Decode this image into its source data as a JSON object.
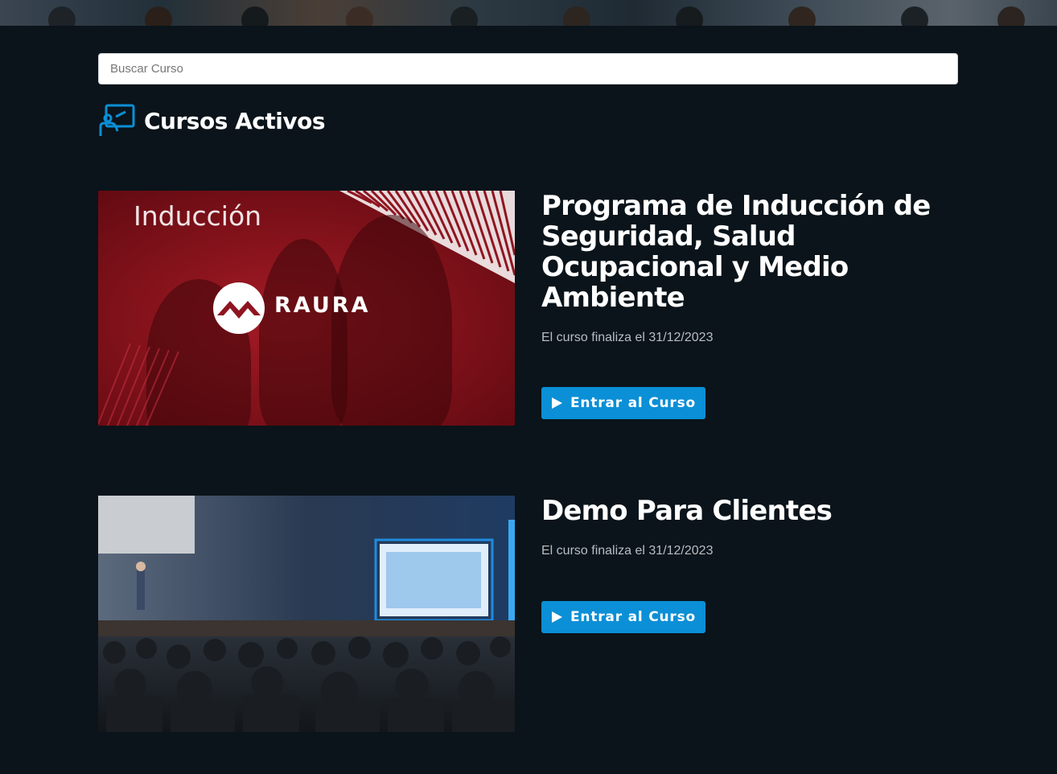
{
  "search": {
    "placeholder": "Buscar Curso"
  },
  "section": {
    "title": "Cursos Activos",
    "icon": "presentation-board-icon"
  },
  "courses": [
    {
      "title": "Programa de Inducción de Seguridad, Salud Ocupacional y Medio Ambiente",
      "end_date_text": "El curso finaliza el 31/12/2023",
      "button_label": "Entrar al Curso",
      "thumbnail": {
        "label": "Inducción",
        "brand": "RAURA"
      }
    },
    {
      "title": "Demo Para Clientes",
      "end_date_text": "El curso finaliza el 31/12/2023",
      "button_label": "Entrar al Curso"
    }
  ],
  "colors": {
    "background": "#0a141a",
    "accent": "#0b8fd6",
    "thumbnail_red": "#8e1520"
  }
}
